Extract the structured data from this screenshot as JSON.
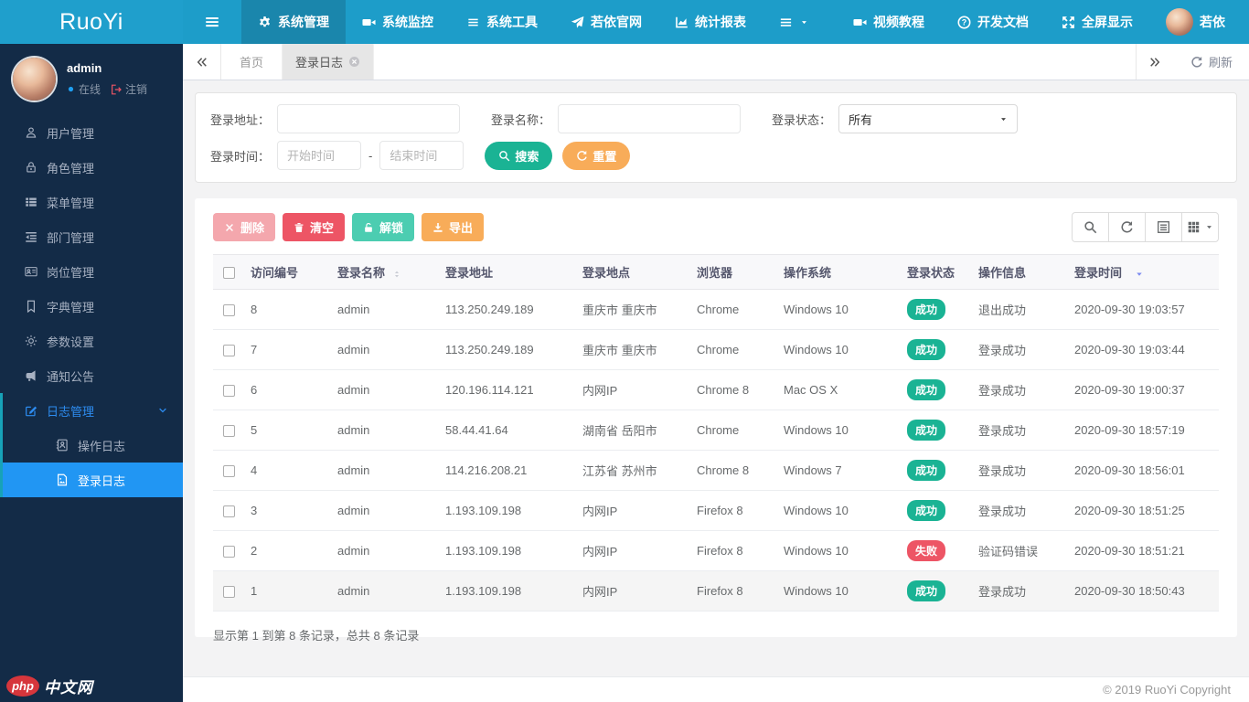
{
  "app": {
    "name": "RuoYi",
    "copyright": "© 2019 RuoYi Copyright",
    "watermark_badge": "php",
    "watermark_text": "中文网"
  },
  "colors": {
    "header": "#1d9dc9",
    "sidebar": "#132b47",
    "active_blue": "#2196f3",
    "success": "#1ab394",
    "danger": "#ed5565",
    "warning": "#f8ac59",
    "unlock_teal": "#4ccdb1"
  },
  "topnav": {
    "items": [
      {
        "key": "system-manage",
        "label": "系统管理",
        "icon": "gear",
        "active": true
      },
      {
        "key": "system-monitor",
        "label": "系统监控",
        "icon": "video"
      },
      {
        "key": "system-tools",
        "label": "系统工具",
        "icon": "list"
      },
      {
        "key": "ruoyi-site",
        "label": "若依官网",
        "icon": "send"
      },
      {
        "key": "stats-report",
        "label": "统计报表",
        "icon": "chart"
      },
      {
        "key": "more-menu",
        "label": "",
        "icon": "bars",
        "caret": true
      }
    ],
    "right": [
      {
        "key": "video-tutorial",
        "label": "视频教程",
        "icon": "video"
      },
      {
        "key": "dev-docs",
        "label": "开发文档",
        "icon": "question"
      },
      {
        "key": "fullscreen",
        "label": "全屏显示",
        "icon": "fullscreen"
      },
      {
        "key": "profile",
        "label": "若依",
        "icon": "avatar"
      }
    ]
  },
  "sidebar": {
    "user": {
      "name": "admin",
      "status": "在线",
      "logout": "注销"
    },
    "items": [
      {
        "key": "user-manage",
        "label": "用户管理",
        "icon": "user"
      },
      {
        "key": "role-manage",
        "label": "角色管理",
        "icon": "role"
      },
      {
        "key": "menu-manage",
        "label": "菜单管理",
        "icon": "menu"
      },
      {
        "key": "dept-manage",
        "label": "部门管理",
        "icon": "dept"
      },
      {
        "key": "post-manage",
        "label": "岗位管理",
        "icon": "post"
      },
      {
        "key": "dict-manage",
        "label": "字典管理",
        "icon": "dict"
      },
      {
        "key": "param-settings",
        "label": "参数设置",
        "icon": "param"
      },
      {
        "key": "notice",
        "label": "通知公告",
        "icon": "notice"
      },
      {
        "key": "log-manage",
        "label": "日志管理",
        "icon": "log",
        "expanded": true,
        "children": [
          {
            "key": "operation-log",
            "label": "操作日志",
            "icon": "oplog"
          },
          {
            "key": "login-log",
            "label": "登录日志",
            "icon": "loginlog",
            "active": true
          }
        ]
      }
    ]
  },
  "tabs": {
    "items": [
      {
        "key": "home",
        "label": "首页"
      },
      {
        "key": "login-log",
        "label": "登录日志",
        "active": true,
        "closable": true
      }
    ],
    "refresh": "刷新"
  },
  "search": {
    "fields": {
      "address_label": "登录地址：",
      "name_label": "登录名称：",
      "status_label": "登录状态：",
      "status_value": "所有",
      "time_label": "登录时间：",
      "start_placeholder": "开始时间",
      "end_placeholder": "结束时间",
      "separator": "-"
    },
    "buttons": {
      "search": "搜索",
      "reset": "重置"
    }
  },
  "toolbar": {
    "delete": "删除",
    "clear": "清空",
    "unlock": "解锁",
    "export": "导出"
  },
  "table": {
    "columns": [
      {
        "label": "访问编号"
      },
      {
        "label": "登录名称",
        "sort": "both"
      },
      {
        "label": "登录地址"
      },
      {
        "label": "登录地点"
      },
      {
        "label": "浏览器"
      },
      {
        "label": "操作系统"
      },
      {
        "label": "登录状态"
      },
      {
        "label": "操作信息"
      },
      {
        "label": "登录时间",
        "sort": "desc"
      }
    ],
    "rows": [
      {
        "id": "8",
        "name": "admin",
        "ip": "113.250.249.189",
        "location": "重庆市 重庆市",
        "browser": "Chrome",
        "os": "Windows 10",
        "status": "成功",
        "status_type": "success",
        "message": "退出成功",
        "time": "2020-09-30 19:03:57"
      },
      {
        "id": "7",
        "name": "admin",
        "ip": "113.250.249.189",
        "location": "重庆市 重庆市",
        "browser": "Chrome",
        "os": "Windows 10",
        "status": "成功",
        "status_type": "success",
        "message": "登录成功",
        "time": "2020-09-30 19:03:44"
      },
      {
        "id": "6",
        "name": "admin",
        "ip": "120.196.114.121",
        "location": "内网IP",
        "browser": "Chrome 8",
        "os": "Mac OS X",
        "status": "成功",
        "status_type": "success",
        "message": "登录成功",
        "time": "2020-09-30 19:00:37"
      },
      {
        "id": "5",
        "name": "admin",
        "ip": "58.44.41.64",
        "location": "湖南省 岳阳市",
        "browser": "Chrome",
        "os": "Windows 10",
        "status": "成功",
        "status_type": "success",
        "message": "登录成功",
        "time": "2020-09-30 18:57:19"
      },
      {
        "id": "4",
        "name": "admin",
        "ip": "114.216.208.21",
        "location": "江苏省 苏州市",
        "browser": "Chrome 8",
        "os": "Windows 7",
        "status": "成功",
        "status_type": "success",
        "message": "登录成功",
        "time": "2020-09-30 18:56:01"
      },
      {
        "id": "3",
        "name": "admin",
        "ip": "1.193.109.198",
        "location": "内网IP",
        "browser": "Firefox 8",
        "os": "Windows 10",
        "status": "成功",
        "status_type": "success",
        "message": "登录成功",
        "time": "2020-09-30 18:51:25"
      },
      {
        "id": "2",
        "name": "admin",
        "ip": "1.193.109.198",
        "location": "内网IP",
        "browser": "Firefox 8",
        "os": "Windows 10",
        "status": "失败",
        "status_type": "fail",
        "message": "验证码错误",
        "time": "2020-09-30 18:51:21"
      },
      {
        "id": "1",
        "name": "admin",
        "ip": "1.193.109.198",
        "location": "内网IP",
        "browser": "Firefox 8",
        "os": "Windows 10",
        "status": "成功",
        "status_type": "success",
        "message": "登录成功",
        "time": "2020-09-30 18:50:43"
      }
    ],
    "summary": "显示第 1 到第 8 条记录，总共 8 条记录"
  }
}
